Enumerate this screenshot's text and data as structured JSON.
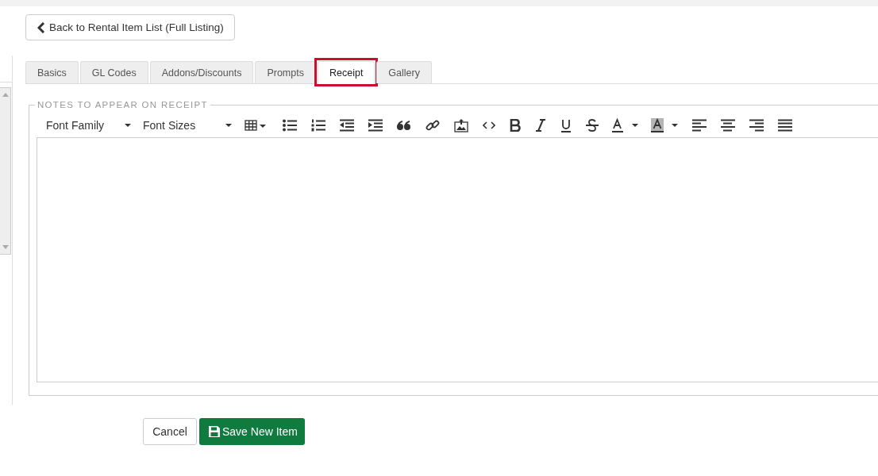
{
  "back_button": {
    "label": "Back to Rental Item List (Full Listing)"
  },
  "tabs": [
    {
      "label": "Basics",
      "selected": false,
      "highlighted": false
    },
    {
      "label": "GL Codes",
      "selected": false,
      "highlighted": false
    },
    {
      "label": "Addons/Discounts",
      "selected": false,
      "highlighted": false
    },
    {
      "label": "Prompts",
      "selected": false,
      "highlighted": false
    },
    {
      "label": "Receipt",
      "selected": true,
      "highlighted": true
    },
    {
      "label": "Gallery",
      "selected": false,
      "highlighted": false
    }
  ],
  "section": {
    "legend": "NOTES TO APPEAR ON RECEIPT"
  },
  "toolbar": {
    "font_family": "Font Family",
    "font_sizes": "Font Sizes"
  },
  "actions": [
    {
      "label": "Cancel",
      "kind": "cancel"
    },
    {
      "label": "Save New Item",
      "kind": "save"
    }
  ]
}
